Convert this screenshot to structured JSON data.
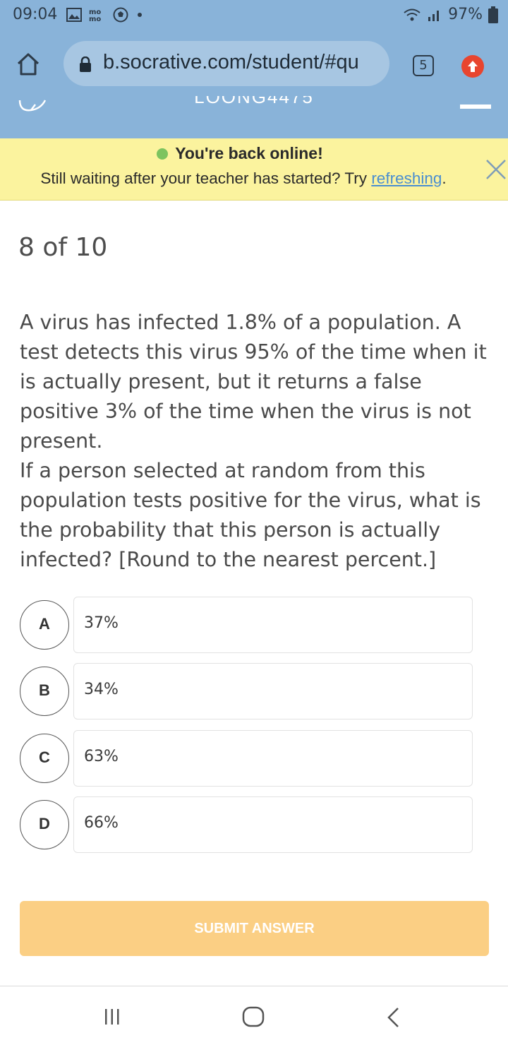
{
  "status_bar": {
    "time": "09:04",
    "battery": "97%",
    "icons": [
      "gallery-icon",
      "mo-icon",
      "soccer-ball-icon",
      "dot-icon",
      "wifi-icon",
      "signal-icon",
      "battery-icon"
    ]
  },
  "browser": {
    "url": "b.socrative.com/student/#qu",
    "tab_count": "5"
  },
  "app_header": {
    "room_code": "LOONG4475"
  },
  "banner": {
    "title": "You're back online!",
    "subtitle_prefix": "Still waiting after your teacher has started? Try ",
    "link_text": "refreshing",
    "subtitle_suffix": ".",
    "status_color": "#7cc35f"
  },
  "question": {
    "progress": "8 of 10",
    "paragraph_1": "A virus has infected 1.8% of a population. A test detects this virus 95% of the time when it is actually present, but it returns a false positive 3% of the time when the virus is not present.",
    "paragraph_2": "If a person selected at random from this population tests positive for the virus, what is the probability that this person is actually infected? [Round to the nearest percent.]"
  },
  "options": [
    {
      "letter": "A",
      "text": "37%"
    },
    {
      "letter": "B",
      "text": "34%"
    },
    {
      "letter": "C",
      "text": "63%"
    },
    {
      "letter": "D",
      "text": "66%"
    }
  ],
  "submit_label": "SUBMIT ANSWER",
  "colors": {
    "header_bg": "#89b3d9",
    "banner_bg": "#fbf39e",
    "submit_bg": "#fbcf84"
  }
}
